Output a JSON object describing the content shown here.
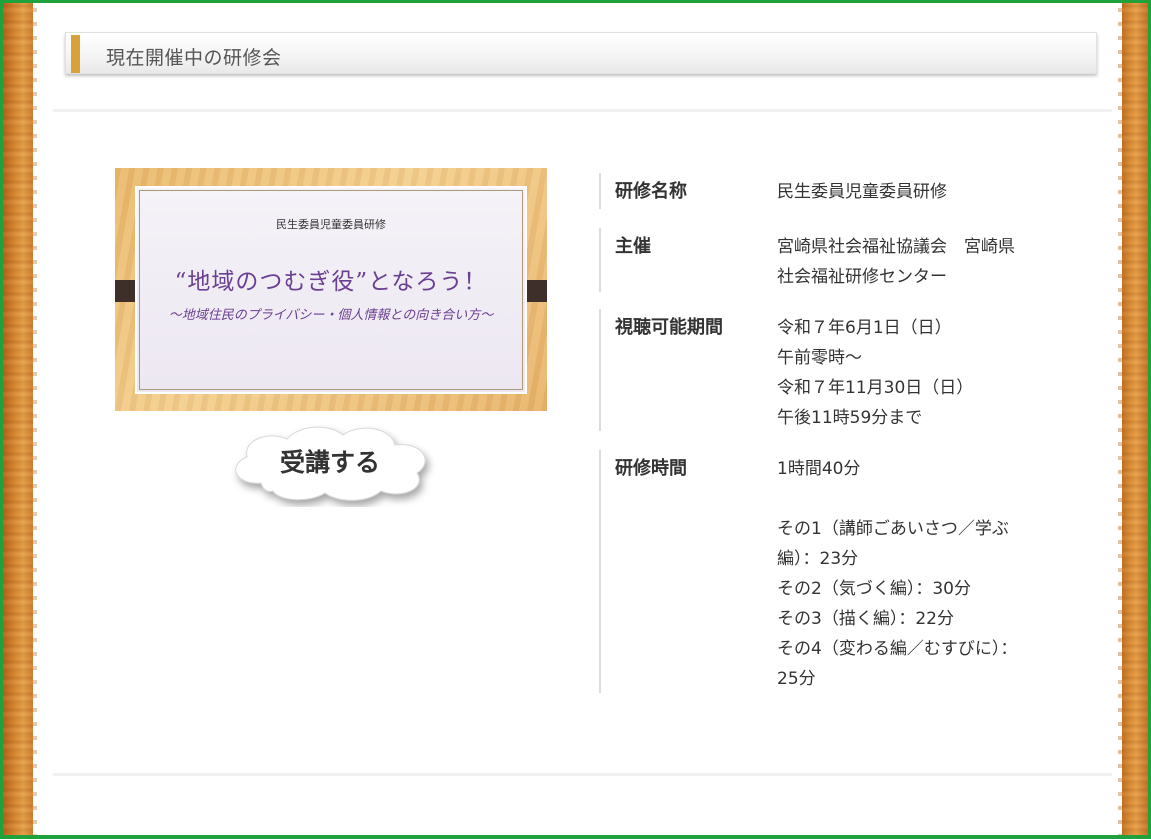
{
  "section": {
    "title": "現在開催中の研修会"
  },
  "banner": {
    "org": "民生委員児童委員研修",
    "main_title": "“地域のつむぎ役”となろう！",
    "sub_title": "～地域住民のプライバシー・個人情報との向き合い方～"
  },
  "enroll_button": {
    "label": "受講する"
  },
  "details": {
    "name": {
      "label": "研修名称",
      "lines": [
        "民生委員児童委員研修"
      ]
    },
    "host": {
      "label": "主催",
      "lines": [
        "宮崎県社会福祉協議会　宮崎県",
        "社会福祉研修センター"
      ]
    },
    "period": {
      "label": "視聴可能期間",
      "lines": [
        "令和７年6月1日（日）",
        "午前零時～",
        "令和７年11月30日（日）",
        "午後11時59分まで"
      ]
    },
    "duration": {
      "label": "研修時間",
      "lines": [
        "1時間40分",
        "",
        "その1（講師ごあいさつ／学ぶ",
        "編）：23分",
        "その2（気づく編）：30分",
        "その3（描く編）：22分",
        "その4（変わる編／むすびに）：",
        "25分"
      ]
    }
  },
  "colors": {
    "frame_border": "#1fa13c",
    "accent": "#d8a23b",
    "title_purple": "#6b3f92"
  }
}
